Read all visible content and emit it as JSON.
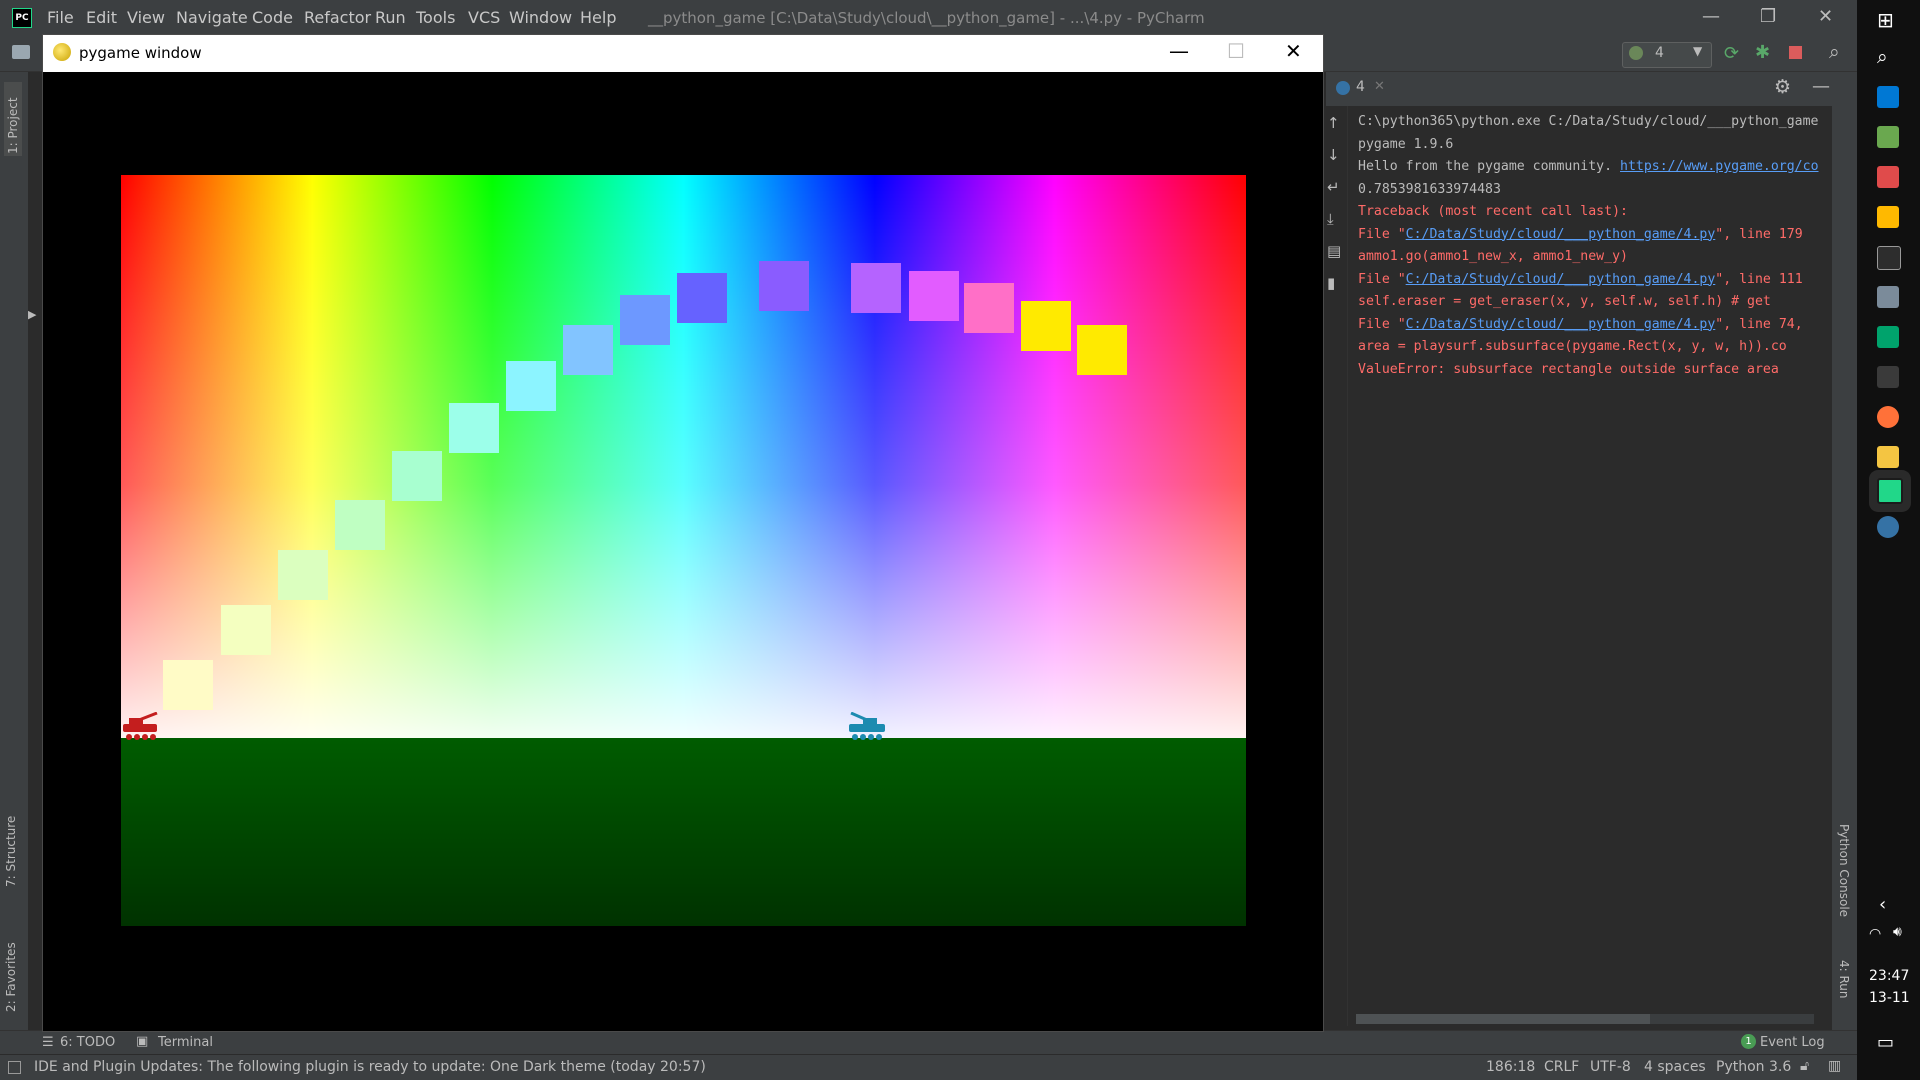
{
  "ide": {
    "menu": [
      "File",
      "Edit",
      "View",
      "Navigate",
      "Code",
      "Refactor",
      "Run",
      "Tools",
      "VCS",
      "Window",
      "Help"
    ],
    "title": "__python_game [C:\\Data\\Study\\cloud\\__python_game] - ...\\4.py - PyCharm",
    "run_config": "4",
    "run_tab": "4",
    "left_tabs": {
      "project": "1: Project",
      "structure": "7: Structure",
      "favorites": "2: Favorites"
    },
    "right_tabs": {
      "python_console": "Python Console",
      "run": "4: Run"
    }
  },
  "pygame_window": {
    "title": "pygame window",
    "squares": [
      {
        "color": "#fffbc6"
      },
      {
        "color": "#f4ffc0"
      },
      {
        "color": "#dbffbf"
      },
      {
        "color": "#bfffc2"
      },
      {
        "color": "#a8ffd0"
      },
      {
        "color": "#9cffea"
      },
      {
        "color": "#8cf4ff"
      },
      {
        "color": "#82c4ff"
      },
      {
        "color": "#6d98ff"
      },
      {
        "color": "#6662ff"
      },
      {
        "color": "#8a5cff"
      },
      {
        "color": "#b563ff"
      },
      {
        "color": "#e25cff"
      },
      {
        "color": "#ff6fc7"
      },
      {
        "color": "#ffea00"
      },
      {
        "color": "#ffea00"
      }
    ],
    "tank_colors": {
      "left": "#c41e1e",
      "right": "#1c8bb0"
    }
  },
  "console": {
    "lines": [
      {
        "text": "C:\\python365\\python.exe C:/Data/Study/cloud/___python_game",
        "kind": "gray"
      },
      {
        "text": "pygame 1.9.6",
        "kind": "gray"
      },
      {
        "text": "Hello from the pygame community. ",
        "link": "https://www.pygame.org/co",
        "kind": "gray"
      },
      {
        "text": "0.7853981633974483",
        "kind": "gray"
      },
      {
        "text": "Traceback (most recent call last):",
        "kind": "red"
      },
      {
        "pre": "  File \"",
        "link": "C:/Data/Study/cloud/___python_game/4.py",
        "post": "\", line 179",
        "kind": "red"
      },
      {
        "text": "    ammo1.go(ammo1_new_x, ammo1_new_y)",
        "kind": "red"
      },
      {
        "pre": "  File \"",
        "link": "C:/Data/Study/cloud/___python_game/4.py",
        "post": "\", line 111",
        "kind": "red"
      },
      {
        "text": "    self.eraser = get_eraser(x, y, self.w, self.h)  # get",
        "kind": "red"
      },
      {
        "pre": "  File \"",
        "link": "C:/Data/Study/cloud/___python_game/4.py",
        "post": "\", line 74,",
        "kind": "red"
      },
      {
        "text": "    area = playsurf.subsurface(pygame.Rect(x, y, w, h)).co",
        "kind": "red"
      },
      {
        "text": "ValueError: subsurface rectangle outside surface area",
        "kind": "red"
      }
    ]
  },
  "bottom_tools": {
    "todo": "6: TODO",
    "terminal": "Terminal",
    "event_log": "Event Log",
    "event_count": "1"
  },
  "status": {
    "message": "IDE and Plugin Updates: The following plugin is ready to update: One Dark theme (today 20:57)",
    "position": "186:18",
    "line_sep": "CRLF",
    "encoding": "UTF-8",
    "indent": "4 spaces",
    "interpreter": "Python 3.6"
  },
  "taskbar": {
    "time": "23:47",
    "date": "13-11"
  }
}
